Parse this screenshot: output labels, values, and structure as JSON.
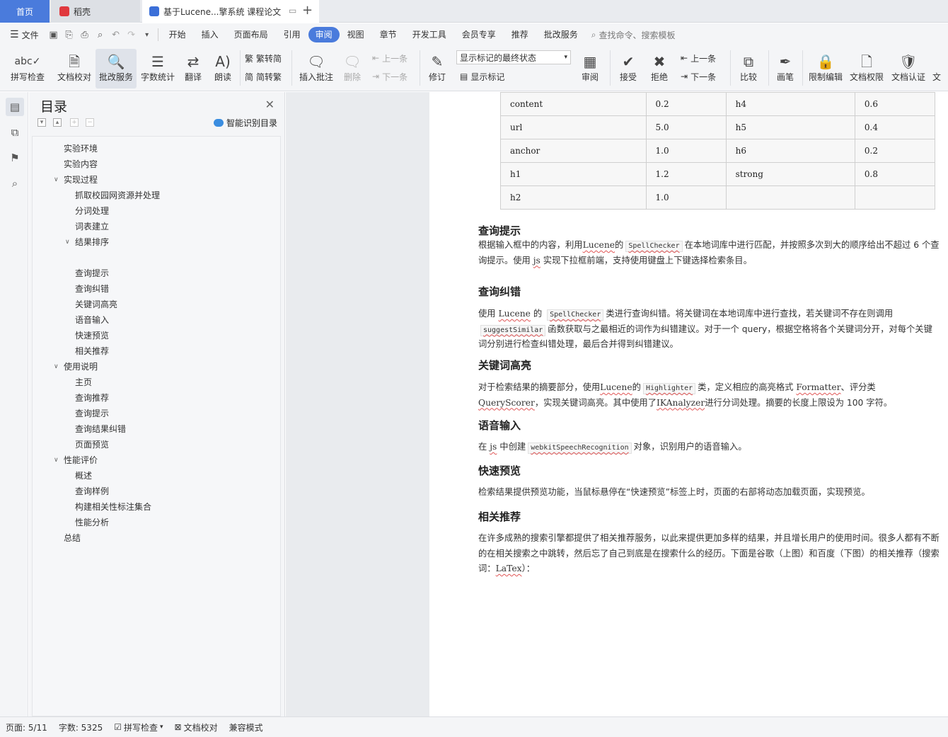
{
  "tabs": {
    "home": "首页",
    "daoke": "稻壳",
    "doc": "基于Lucene...擎系统 课程论文"
  },
  "menu": {
    "file": "文件",
    "items": [
      "开始",
      "插入",
      "页面布局",
      "引用",
      "审阅",
      "视图",
      "章节",
      "开发工具",
      "会员专享",
      "推荐",
      "批改服务"
    ],
    "search": "查找命令、搜索模板"
  },
  "ribbon": {
    "spell": "拼写检查",
    "proofread": "文档校对",
    "correct_service": "批改服务",
    "wordcount": "字数统计",
    "translate": "翻译",
    "read": "朗读",
    "trad": "繁转简",
    "simp": "简转繁",
    "insert_comment": "插入批注",
    "delete": "删除",
    "prev": "上一条",
    "next": "下一条",
    "revise": "修订",
    "markup_state": "显示标记的最终状态",
    "show_markup": "显示标记",
    "review": "审阅",
    "accept": "接受",
    "reject": "拒绝",
    "prev2": "上一条",
    "next2": "下一条",
    "compare": "比较",
    "pen": "画笔",
    "restrict": "限制编辑",
    "perm": "文档权限",
    "cert": "文档认证",
    "doc_more": "文"
  },
  "toc": {
    "title": "目录",
    "smart": "智能识别目录",
    "items": [
      {
        "label": "实验环境",
        "level": 1
      },
      {
        "label": "实验内容",
        "level": 1
      },
      {
        "label": "实现过程",
        "level": 1
      },
      {
        "label": "抓取校园网资源并处理",
        "level": 2
      },
      {
        "label": "分词处理",
        "level": 2
      },
      {
        "label": "词表建立",
        "level": 2
      },
      {
        "label": "结果排序",
        "level": 2
      },
      {
        "label": "查询提示",
        "level": 2
      },
      {
        "label": "查询纠错",
        "level": 2
      },
      {
        "label": "关键词高亮",
        "level": 2
      },
      {
        "label": "语音输入",
        "level": 2
      },
      {
        "label": "快速预览",
        "level": 2
      },
      {
        "label": "相关推荐",
        "level": 2
      },
      {
        "label": "使用说明",
        "level": 1
      },
      {
        "label": "主页",
        "level": 2
      },
      {
        "label": "查询推荐",
        "level": 2
      },
      {
        "label": "查询提示",
        "level": 2
      },
      {
        "label": "查询结果纠错",
        "level": 2
      },
      {
        "label": "页面预览",
        "level": 2
      },
      {
        "label": "性能评价",
        "level": 1
      },
      {
        "label": "概述",
        "level": 2
      },
      {
        "label": "查询样例",
        "level": 2
      },
      {
        "label": "构建相关性标注集合",
        "level": 2
      },
      {
        "label": "性能分析",
        "level": 2
      },
      {
        "label": "总结",
        "level": 1
      }
    ]
  },
  "table": [
    [
      "content",
      "0.2",
      "h4",
      "0.6"
    ],
    [
      "url",
      "5.0",
      "h5",
      "0.4"
    ],
    [
      "anchor",
      "1.0",
      "h6",
      "0.2"
    ],
    [
      "h1",
      "1.2",
      "strong",
      "0.8"
    ],
    [
      "h2",
      "1.0",
      "",
      ""
    ]
  ],
  "doc": {
    "s1_title": "查询提示",
    "s1_a": "根据输入框中的内容，利用",
    "s1_lucene": "Lucene",
    "s1_b": "的",
    "s1_code": "SpellChecker",
    "s1_c": "在本地词库中进行匹配，并按照多次到大的顺序给出不超过 6 个查询提示。使用",
    "s1_js": "js",
    "s1_d": "实现下拉框前端，支持使用键盘上下键选择检索条目。",
    "s2_title": "查询纠错",
    "s2_a": "使用 ",
    "s2_lucene": "Lucene",
    "s2_b": " 的 ",
    "s2_code1": "SpellChecker",
    "s2_c": "类进行查询纠错。将关键词在本地词库中进行查找，若关键词不存在则调用",
    "s2_code2": "suggestSimilar",
    "s2_d": "函数获取与之最相近的词作为纠错建议。对于一个 query，根据空格将各个关键词分开，对每个关键词分别进行检查纠错处理，最后合并得到纠错建议。",
    "s3_title": "关键词高亮",
    "s3_a": "对于检索结果的摘要部分，使用",
    "s3_lucene": "Lucene",
    "s3_b": "的",
    "s3_code": "Highlighter",
    "s3_c": "类，定义相应的高亮格式 ",
    "s3_fmt": "Formatter",
    "s3_d": "、评分类",
    "s3_qs": "QueryScorer",
    "s3_e": "，实现关键词高亮。其中使用了",
    "s3_ik": "IKAnalyzer",
    "s3_f": "进行分词处理。摘要的长度上限设为 100 字符。",
    "s4_title": "语音输入",
    "s4_a": "在",
    "s4_js": "js",
    "s4_b": "中创建",
    "s4_code": "webkitSpeechRecognition",
    "s4_c": "对象，识别用户的语音输入。",
    "s5_title": "快速预览",
    "s5_a": "检索结果提供预览功能，当鼠标悬停在“快速预览”标签上时，页面的右部将动态加载页面，实现预览。",
    "s6_title": "相关推荐",
    "s6_a": "在许多成熟的搜索引擎都提供了相关推荐服务，以此来提供更加多样的结果，并且增长用户的使用时间。很多人都有不断的在相关搜索之中跳转，然后忘了自己到底是在搜索什么的经历。下面是谷歌（上图）和百度（下图）的相关推荐（搜索词：",
    "s6_latex": "LaTex",
    "s6_b": "）："
  },
  "status": {
    "page": "页面: 5/11",
    "words": "字数: 5325",
    "spell": "拼写检查",
    "proof": "文档校对",
    "compat": "兼容模式"
  },
  "colors": {
    "accent": "#4a7bdc",
    "tabbar": "#e9ebef",
    "ribbon": "#f4f5f7"
  }
}
